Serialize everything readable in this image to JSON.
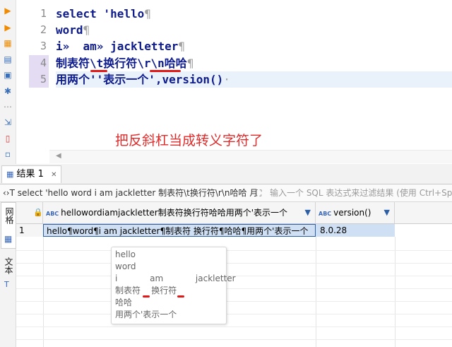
{
  "editor": {
    "line_numbers": [
      "1",
      "2",
      "3",
      "4",
      "5"
    ],
    "lines": [
      {
        "main": "select 'hello",
        "pil": "¶"
      },
      {
        "main": "word",
        "pil": "¶"
      },
      {
        "main": "i»  am» jackletter",
        "pil": "¶"
      },
      {
        "main": "制表符\\t换行符\\r\\n哈哈",
        "pil": "¶"
      },
      {
        "main": "用两个''表示一个',version()",
        "pil": "·"
      }
    ],
    "annotation": "把反斜杠当成转义字符了"
  },
  "results": {
    "tab_label": "结果 1",
    "tab_close": "✕",
    "query_text": "‹›T select 'hello word i am jackletter 制表符\\t换行符\\r\\n哈哈 月",
    "filter_placeholder": "输入一个 SQL 表达式来过滤结果 (使用 Ctrl+Space)",
    "side_tabs": [
      "网格",
      "文本"
    ],
    "columns": [
      {
        "abc": "ABC",
        "name": "hellowordiamjackletter制表符换行符哈哈用两个'表示一个"
      },
      {
        "abc": "ABC",
        "name": "version()"
      }
    ],
    "rows": [
      {
        "num": "1",
        "cells": [
          "hello¶word¶i am jackletter¶制表符 换行符¶哈哈¶用两个'表示一个",
          "8.0.28"
        ]
      }
    ],
    "tooltip_lines": [
      "hello",
      "word",
      "i            am            jackletter",
      "制表符    换行符",
      "哈哈",
      "用两个'表示一个"
    ]
  },
  "colors": {
    "accent": "#3a68b8",
    "selected_cell": "#cfe0f4",
    "annotation_red": "#e02b2b"
  }
}
